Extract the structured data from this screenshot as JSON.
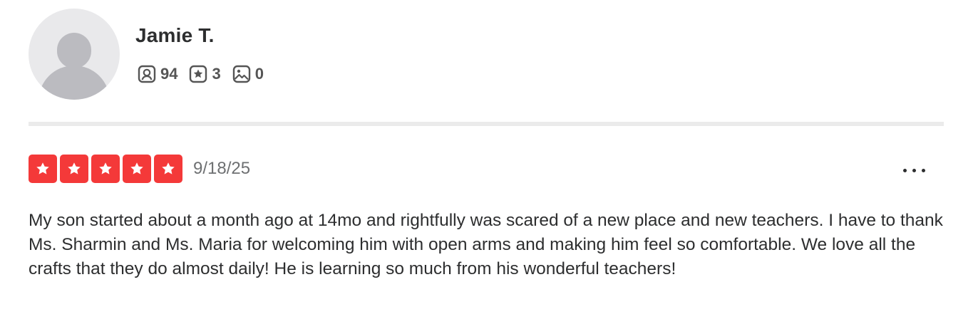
{
  "reviewer": {
    "name": "Jamie T.",
    "friends_count": "94",
    "reviews_count": "3",
    "photos_count": "0"
  },
  "review": {
    "rating": 5,
    "date": "9/18/25",
    "text": "My son started about a month ago at 14mo and rightfully was scared of a new place and new teachers. I have to thank Ms. Sharmin and Ms. Maria for welcoming him with open arms and making him feel so comfortable. We love all the crafts that they do almost daily! He is learning so much from his wonderful teachers!"
  },
  "icons": {
    "friends": "friends-icon",
    "reviews": "review-star-icon",
    "photos": "photo-icon",
    "more": "more-options-icon"
  },
  "colors": {
    "star_fill": "#f43939",
    "text": "#2d2e2f",
    "muted": "#6e7072"
  }
}
